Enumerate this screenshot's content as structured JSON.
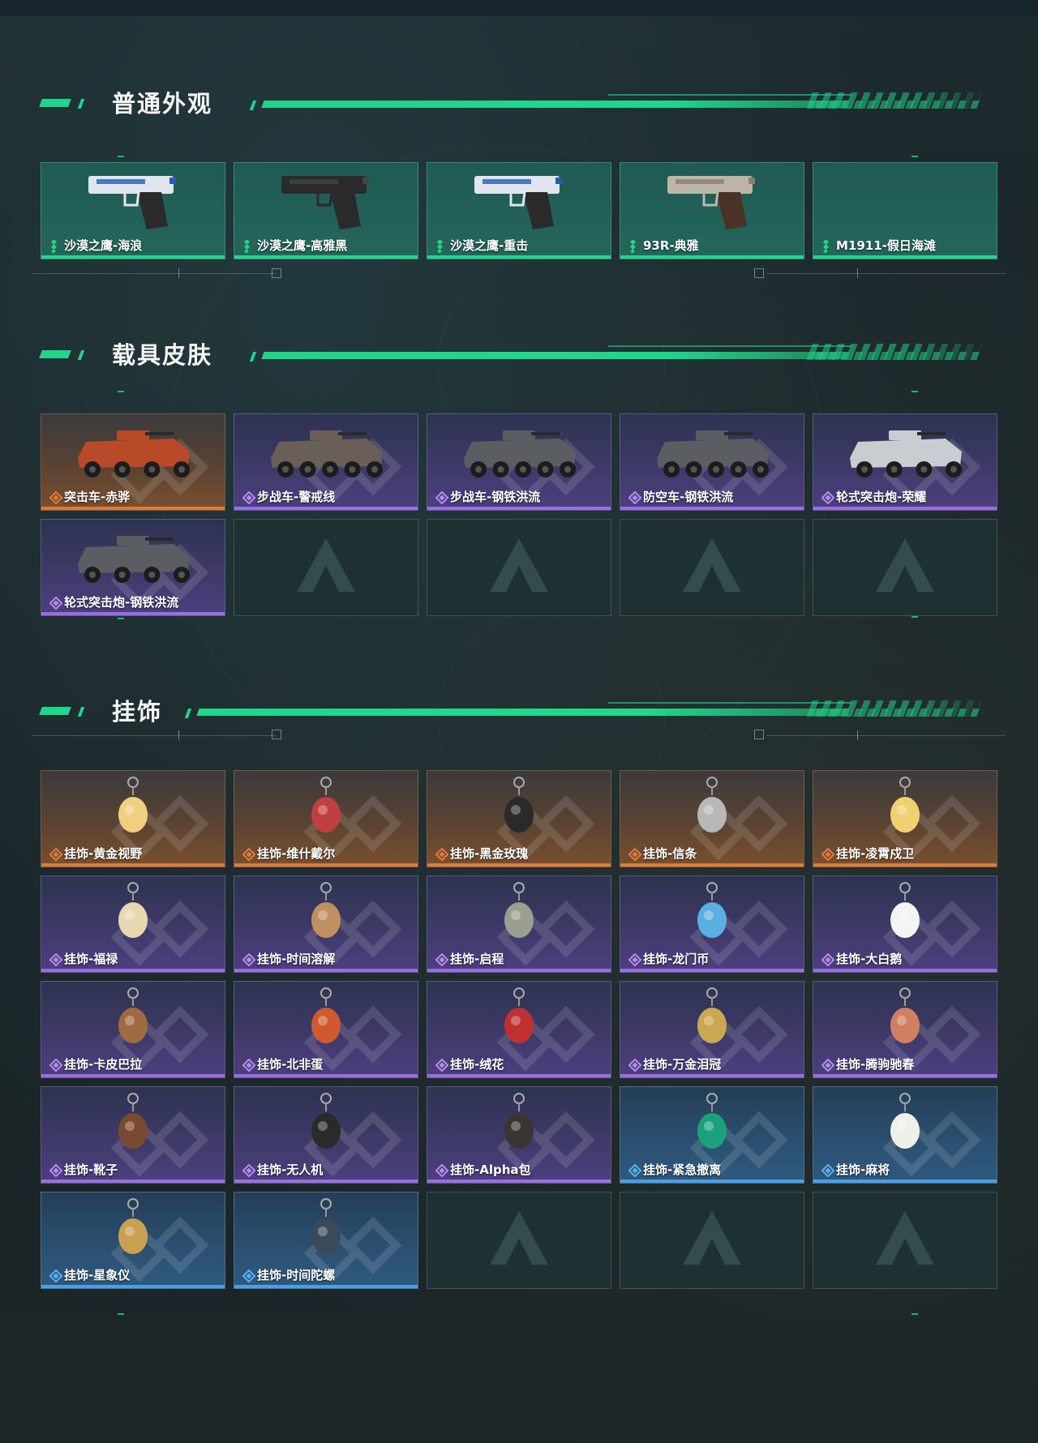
{
  "sections": [
    {
      "title": "普通外观",
      "items": [
        {
          "label": "沙漠之鹰-海浪",
          "rarity": "green",
          "icon": "pistol-deagle-blue-wave"
        },
        {
          "label": "沙漠之鹰-高雅黑",
          "rarity": "green",
          "icon": "pistol-deagle-black"
        },
        {
          "label": "沙漠之鹰-重击",
          "rarity": "green",
          "icon": "pistol-deagle-white-blue"
        },
        {
          "label": "93R-典雅",
          "rarity": "green",
          "icon": "pistol-93r"
        },
        {
          "label": "M1911-假日海滩",
          "rarity": "green",
          "icon": "empty"
        }
      ]
    },
    {
      "title": "载具皮肤",
      "items": [
        {
          "label": "突击车-赤骅",
          "rarity": "orange",
          "icon": "assault-vehicle-red"
        },
        {
          "label": "步战车-警戒线",
          "rarity": "purple",
          "icon": "ifv-warning"
        },
        {
          "label": "步战车-钢铁洪流",
          "rarity": "purple",
          "icon": "ifv-steel"
        },
        {
          "label": "防空车-钢铁洪流",
          "rarity": "purple",
          "icon": "aa-vehicle-steel"
        },
        {
          "label": "轮式突击炮-荣耀",
          "rarity": "purple",
          "icon": "wheeled-assault-gun-glory"
        },
        {
          "label": "轮式突击炮-钢铁洪流",
          "rarity": "purple",
          "icon": "wheeled-assault-gun-steel"
        },
        {
          "label": "",
          "rarity": "empty",
          "icon": "empty-slot"
        },
        {
          "label": "",
          "rarity": "empty",
          "icon": "empty-slot"
        },
        {
          "label": "",
          "rarity": "empty",
          "icon": "empty-slot"
        },
        {
          "label": "",
          "rarity": "empty",
          "icon": "empty-slot"
        }
      ]
    },
    {
      "title": "挂饰",
      "items": [
        {
          "label": "挂饰-黄金视野",
          "rarity": "orange",
          "icon": "charm-figure"
        },
        {
          "label": "挂饰-维什戴尔",
          "rarity": "orange",
          "icon": "charm-tag"
        },
        {
          "label": "挂饰-黑金玫瑰",
          "rarity": "orange",
          "icon": "charm-rose-black"
        },
        {
          "label": "挂饰-信条",
          "rarity": "orange",
          "icon": "charm-creed"
        },
        {
          "label": "挂饰-凌霄戍卫",
          "rarity": "orange",
          "icon": "charm-guardian"
        },
        {
          "label": "挂饰-福禄",
          "rarity": "purple",
          "icon": "charm-gourd"
        },
        {
          "label": "挂饰-时间溶解",
          "rarity": "purple",
          "icon": "charm-clock-melt"
        },
        {
          "label": "挂饰-启程",
          "rarity": "purple",
          "icon": "charm-medal"
        },
        {
          "label": "挂饰-龙门币",
          "rarity": "purple",
          "icon": "charm-coin-card"
        },
        {
          "label": "挂饰-大白鹅",
          "rarity": "purple",
          "icon": "charm-goose"
        },
        {
          "label": "挂饰-卡皮巴拉",
          "rarity": "purple",
          "icon": "charm-capybara"
        },
        {
          "label": "挂饰-北非蛋",
          "rarity": "purple",
          "icon": "charm-shakshuka"
        },
        {
          "label": "挂饰-绒花",
          "rarity": "purple",
          "icon": "charm-velvet-flower"
        },
        {
          "label": "挂饰-万金泪冠",
          "rarity": "purple",
          "icon": "charm-crown"
        },
        {
          "label": "挂饰-腾驹驰春",
          "rarity": "purple",
          "icon": "charm-carriage"
        },
        {
          "label": "挂饰-靴子",
          "rarity": "purple",
          "icon": "charm-boot"
        },
        {
          "label": "挂饰-无人机",
          "rarity": "purple",
          "icon": "charm-drone"
        },
        {
          "label": "挂饰-Alpha包",
          "rarity": "purple",
          "icon": "charm-alpha-pack"
        },
        {
          "label": "挂饰-紧急撤离",
          "rarity": "blue",
          "icon": "charm-emergency"
        },
        {
          "label": "挂饰-麻将",
          "rarity": "blue",
          "icon": "charm-mahjong"
        },
        {
          "label": "挂饰-星象仪",
          "rarity": "blue",
          "icon": "charm-astrolabe"
        },
        {
          "label": "挂饰-时间陀螺",
          "rarity": "blue",
          "icon": "charm-time-top"
        },
        {
          "label": "",
          "rarity": "empty",
          "icon": "empty-slot"
        },
        {
          "label": "",
          "rarity": "empty",
          "icon": "empty-slot"
        },
        {
          "label": "",
          "rarity": "empty",
          "icon": "empty-slot"
        }
      ]
    }
  ],
  "colors": {
    "accent": "#1fd68a",
    "green": "#25665c",
    "orange": "#e07a3a",
    "purple": "#9a6ee0",
    "blue": "#4aa0e8"
  }
}
